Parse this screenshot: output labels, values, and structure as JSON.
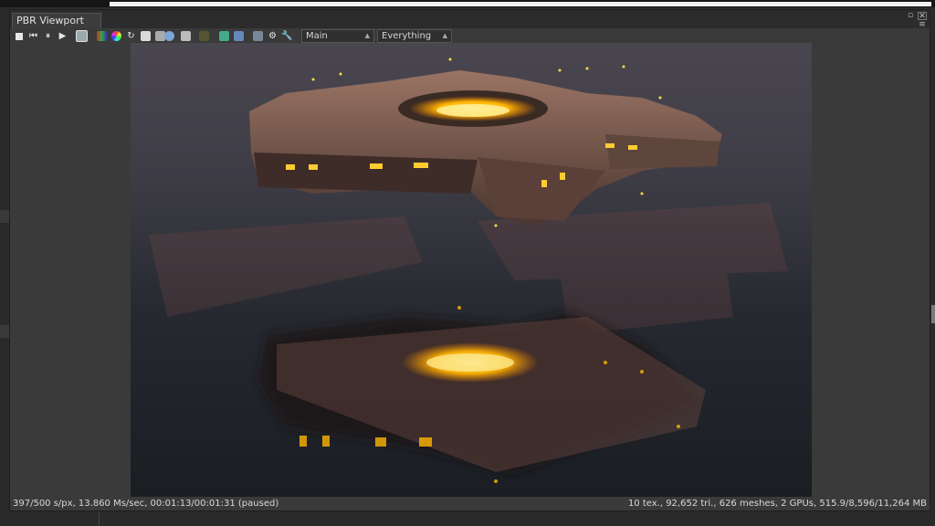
{
  "window": {
    "tab_title": "PBR Viewport",
    "float_icon": "float-window-icon",
    "close_icon": "close-icon",
    "menu_icon": "panel-menu-icon"
  },
  "toolbar": {
    "icons": [
      "stop-icon",
      "rewind-icon",
      "pause-icon",
      "play-icon",
      "render-settings-icon",
      "histogram-icon",
      "color-icon",
      "refresh-icon",
      "lock-icon",
      "clay-render-icon",
      "camera-icon",
      "region-icon",
      "pick-icon",
      "environment-icon",
      "viewport-icon",
      "image-icon",
      "settings-gear-icon",
      "wrench-icon"
    ],
    "camera_select": "Main",
    "filter_select": "Everything"
  },
  "status": {
    "left": "397/500 s/px, 13.860 Ms/sec, 00:01:13/00:01:31 (paused)",
    "right": "10 tex., 92,652 tri., 626 meshes, 2 GPUs, 515.9/8,596/11,264 MB"
  },
  "colors": {
    "glow": "#ffb400",
    "hull": "#7a5a4a",
    "panel_bg": "#3a3a3a"
  }
}
